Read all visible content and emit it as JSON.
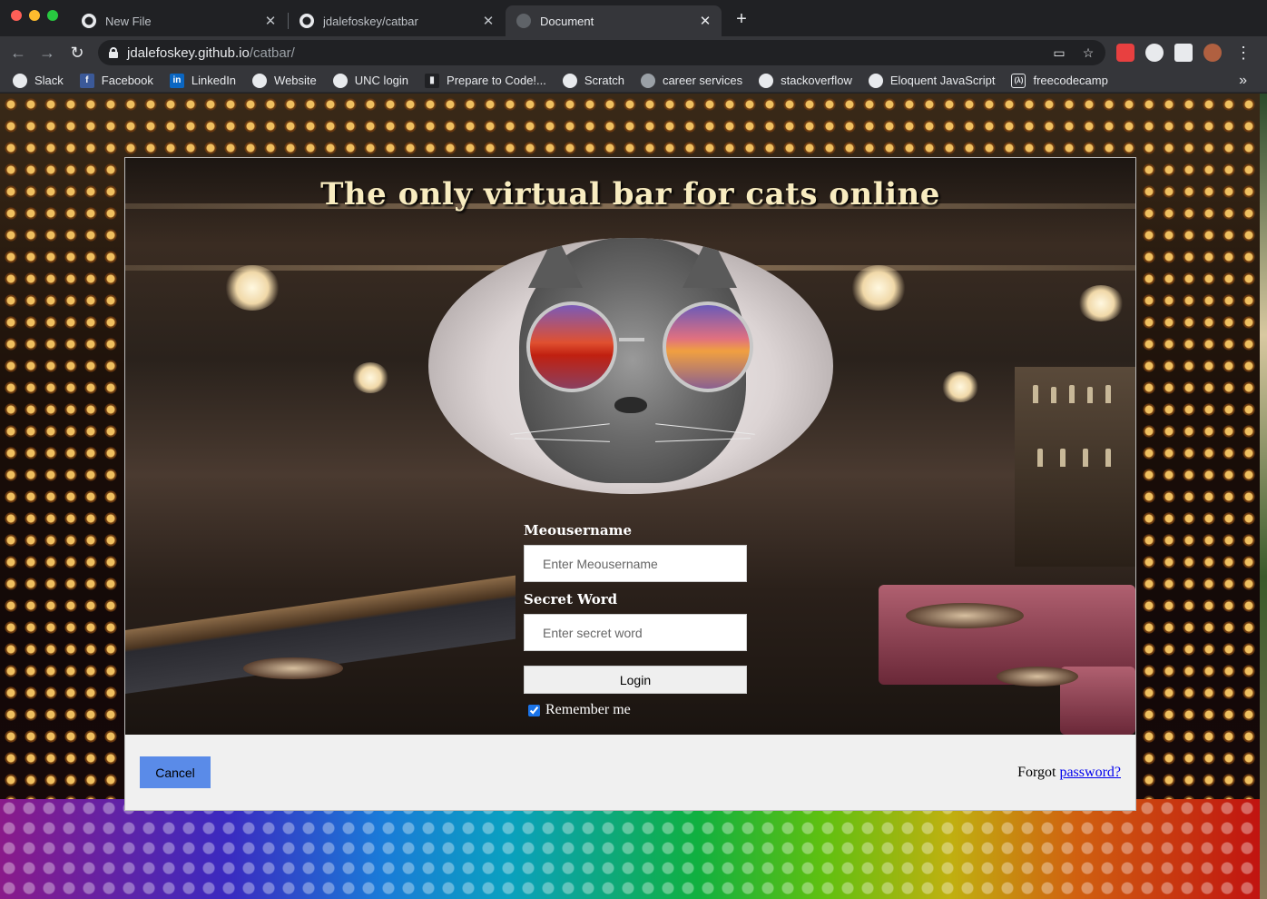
{
  "browser": {
    "tabs": [
      {
        "title": "New File",
        "icon": "github-icon"
      },
      {
        "title": "jdalefoskey/catbar",
        "icon": "github-icon"
      },
      {
        "title": "Document",
        "icon": "globe-icon"
      }
    ],
    "url_host": "jdalefoskey.github.io",
    "url_path": "/catbar/",
    "bookmarks": [
      {
        "label": "Slack"
      },
      {
        "label": "Facebook"
      },
      {
        "label": "LinkedIn"
      },
      {
        "label": "Website"
      },
      {
        "label": "UNC login"
      },
      {
        "label": "Prepare to Code!..."
      },
      {
        "label": "Scratch"
      },
      {
        "label": "career services"
      },
      {
        "label": "stackoverflow"
      },
      {
        "label": "Eloquent JavaScript"
      },
      {
        "label": "freecodecamp"
      }
    ],
    "overflow": "»"
  },
  "page": {
    "title": "The only virtual bar for cats online",
    "form": {
      "username_label": "Meousername",
      "username_placeholder": "Enter Meousername",
      "password_label": "Secret Word",
      "password_placeholder": "Enter secret word",
      "login_label": "Login",
      "remember_label": "Remember me",
      "remember_checked": true
    },
    "footer": {
      "cancel_label": "Cancel",
      "forgot_text": "Forgot",
      "forgot_link": "password?"
    }
  },
  "colors": {
    "title": "#f8ecc0",
    "cancel_button": "#5a8be8",
    "link": "#0000ee"
  }
}
